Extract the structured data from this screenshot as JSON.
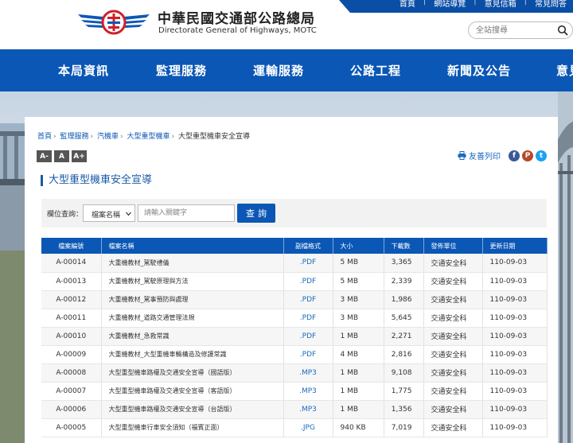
{
  "header": {
    "title_zh": "中華民國交通部公路總局",
    "title_en": "Directorate General of Highways, MOTC",
    "top_links": [
      "首頁",
      "網站導覽",
      "意見信箱",
      "常見問答"
    ],
    "search_placeholder": "全站搜尋",
    "logo_icon": "dgh-emblem-icon",
    "brand_blue": "#0b57b5",
    "logo_red": "#d0202a"
  },
  "nav": {
    "items": [
      "本局資訊",
      "監理服務",
      "運輸服務",
      "公路工程",
      "新聞及公告",
      "意見"
    ]
  },
  "breadcrumb": {
    "items": [
      "首頁",
      "監理服務",
      "汽機車",
      "大型重型機車",
      "大型重型機車安全宣導"
    ],
    "separator": "›"
  },
  "font_size_buttons": [
    "A-",
    "A",
    "A+"
  ],
  "tools": {
    "print_label": "友善列印",
    "share_facebook": "f",
    "share_plurk": "P",
    "share_twitter": "t"
  },
  "page_title": "大型重型機車安全宣導",
  "filter": {
    "label": "欄位查詢：",
    "select_value": "檔案名稱",
    "input_placeholder": "請輸入關鍵字",
    "button_label": "查詢"
  },
  "table": {
    "headers": [
      "檔案編號",
      "檔案名稱",
      "副檔格式",
      "大小",
      "下載數",
      "發佈單位",
      "更新日期"
    ],
    "rows": [
      [
        "A-00014",
        "大重機教材_駕駛禮儀",
        ".PDF",
        "5 MB",
        "3,365",
        "交通安全科",
        "110-09-03"
      ],
      [
        "A-00013",
        "大重機教材_駕駛原理與方法",
        ".PDF",
        "5 MB",
        "2,339",
        "交通安全科",
        "110-09-03"
      ],
      [
        "A-00012",
        "大重機教材_駕事預防與處理",
        ".PDF",
        "3 MB",
        "1,986",
        "交通安全科",
        "110-09-03"
      ],
      [
        "A-00011",
        "大重機教材_道路交通管理法規",
        ".PDF",
        "3 MB",
        "5,645",
        "交通安全科",
        "110-09-03"
      ],
      [
        "A-00010",
        "大重機教材_急救常識",
        ".PDF",
        "1 MB",
        "2,271",
        "交通安全科",
        "110-09-03"
      ],
      [
        "A-00009",
        "大重機教材_大型重機車輛構造及修護常識",
        ".PDF",
        "4 MB",
        "2,816",
        "交通安全科",
        "110-09-03"
      ],
      [
        "A-00008",
        "大型重型機車路權及交通安全宣導（國語版）",
        ".MP3",
        "1 MB",
        "9,108",
        "交通安全科",
        "110-09-03"
      ],
      [
        "A-00007",
        "大型重型機車路權及交通安全宣導（客語版）",
        ".MP3",
        "1 MB",
        "1,775",
        "交通安全科",
        "110-09-03"
      ],
      [
        "A-00006",
        "大型重型機車路權及交通安全宣導（台語版）",
        ".MP3",
        "1 MB",
        "1,356",
        "交通安全科",
        "110-09-03"
      ],
      [
        "A-00005",
        "大型重型機車行車安全須知（福賓正面）",
        ".JPG",
        "940 KB",
        "7,019",
        "交通安全科",
        "110-09-03"
      ]
    ]
  }
}
